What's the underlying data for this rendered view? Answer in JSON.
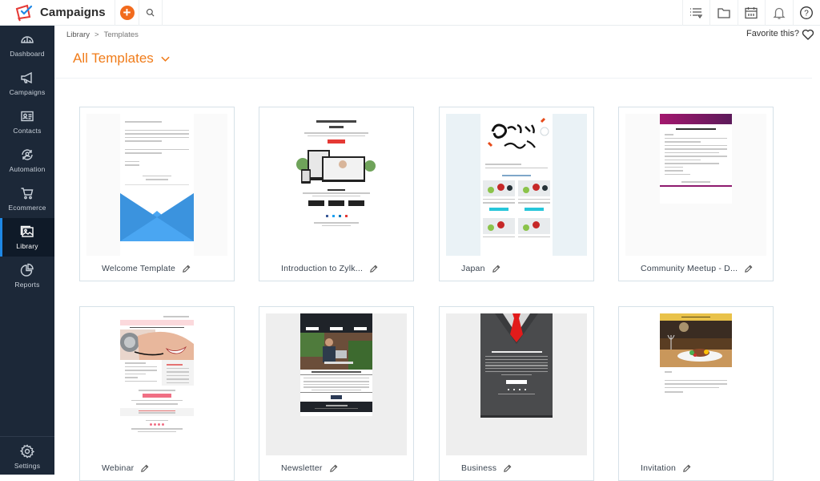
{
  "app": {
    "name": "Campaigns",
    "brand_color": "#f26b1d",
    "sidebar_bg": "#1c2838",
    "accent": "#f07c1a"
  },
  "header": {
    "add_icon": "plus-circle-icon",
    "search_icon": "search-icon",
    "right_icons": [
      "list-filter-icon",
      "folder-icon",
      "calendar-icon",
      "bell-icon",
      "help-icon"
    ]
  },
  "sidebar": {
    "items": [
      {
        "label": "Dashboard",
        "icon": "gauge-icon"
      },
      {
        "label": "Campaigns",
        "icon": "megaphone-icon"
      },
      {
        "label": "Contacts",
        "icon": "contact-card-icon"
      },
      {
        "label": "Automation",
        "icon": "automation-icon"
      },
      {
        "label": "Ecommerce",
        "icon": "cart-icon"
      },
      {
        "label": "Library",
        "icon": "image-library-icon",
        "active": true
      },
      {
        "label": "Reports",
        "icon": "pie-chart-icon"
      }
    ],
    "settings": {
      "label": "Settings",
      "icon": "gear-icon"
    }
  },
  "breadcrumb": {
    "items": [
      "Library",
      "Templates"
    ],
    "separator": ">"
  },
  "favorite": {
    "label": "Favorite this?",
    "icon": "heart-icon"
  },
  "page": {
    "title": "All Templates",
    "dropdown_icon": "chevron-down-icon"
  },
  "templates": [
    {
      "name": "Welcome Template"
    },
    {
      "name": "Introduction to Zylk..."
    },
    {
      "name": "Japan"
    },
    {
      "name": "Community Meetup - D..."
    },
    {
      "name": "Webinar"
    },
    {
      "name": "Newsletter"
    },
    {
      "name": "Business"
    },
    {
      "name": "Invitation"
    }
  ]
}
